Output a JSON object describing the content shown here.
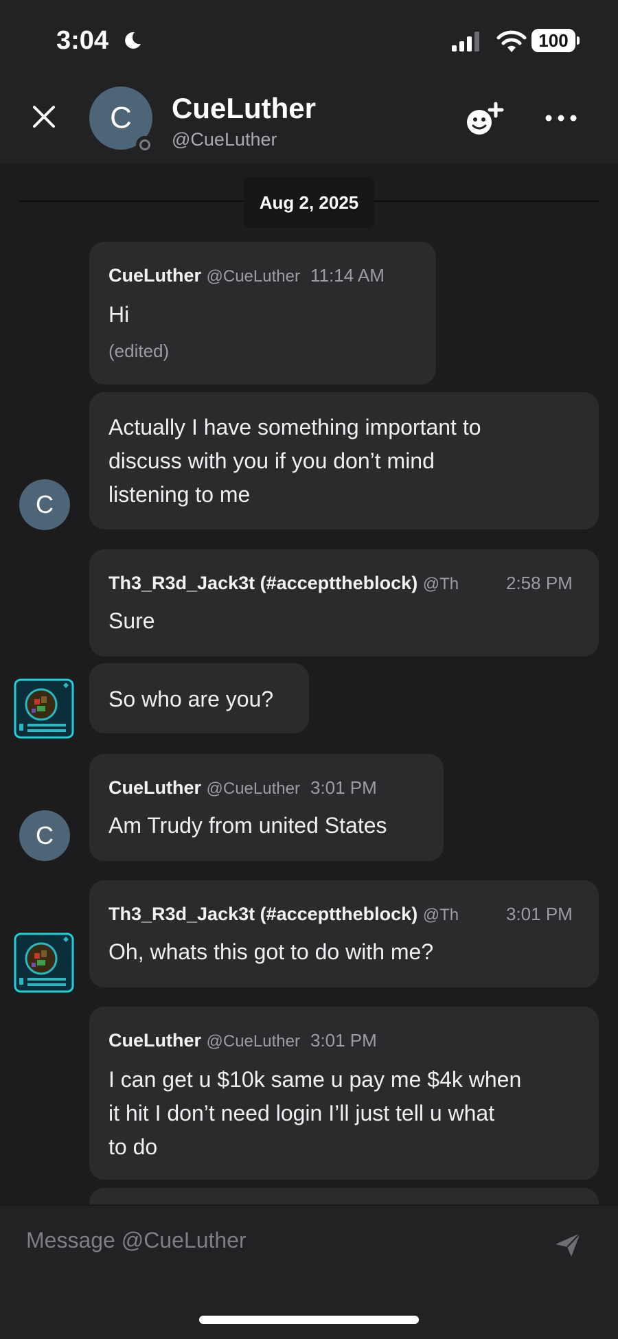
{
  "status_bar": {
    "time": "3:04",
    "battery": "100"
  },
  "header": {
    "avatar_letter": "C",
    "name": "CueLuther",
    "handle": "@CueLuther"
  },
  "date_divider": "Aug 2, 2025",
  "messages": [
    {
      "author": "CueLuther",
      "handle": "@CueLuther",
      "time": "11:14 AM",
      "text": "Hi",
      "edited": "(edited)"
    },
    {
      "text_lines": [
        "Actually I have something important to",
        "discuss with you if you don’t mind",
        "listening to me"
      ],
      "avatar_letter": "C"
    },
    {
      "author": "Th3_R3d_Jack3t (#accepttheblock)",
      "handle": "@Th",
      "time": "2:58 PM",
      "text": "Sure"
    },
    {
      "text": "So who are you?"
    },
    {
      "author": "CueLuther",
      "handle": "@CueLuther",
      "time": "3:01 PM",
      "text": "Am Trudy from united States",
      "avatar_letter": "C"
    },
    {
      "author": "Th3_R3d_Jack3t (#accepttheblock)",
      "handle": "@Th",
      "time": "3:01 PM",
      "text": "Oh, whats this got to do with me?"
    },
    {
      "author": "CueLuther",
      "handle": "@CueLuther",
      "time": "3:01 PM",
      "text_lines": [
        "I can get u $10k same u pay me $4k  when",
        "it hit I don’t need login I’ll just tell u what",
        "to do"
      ]
    }
  ],
  "composer": {
    "placeholder": "Message @CueLuther"
  },
  "colors": {
    "background": "#1c1c1e",
    "bubble": "#2b2b2e",
    "avatar": "#4e6577",
    "muted_text": "#9c9ca2"
  }
}
